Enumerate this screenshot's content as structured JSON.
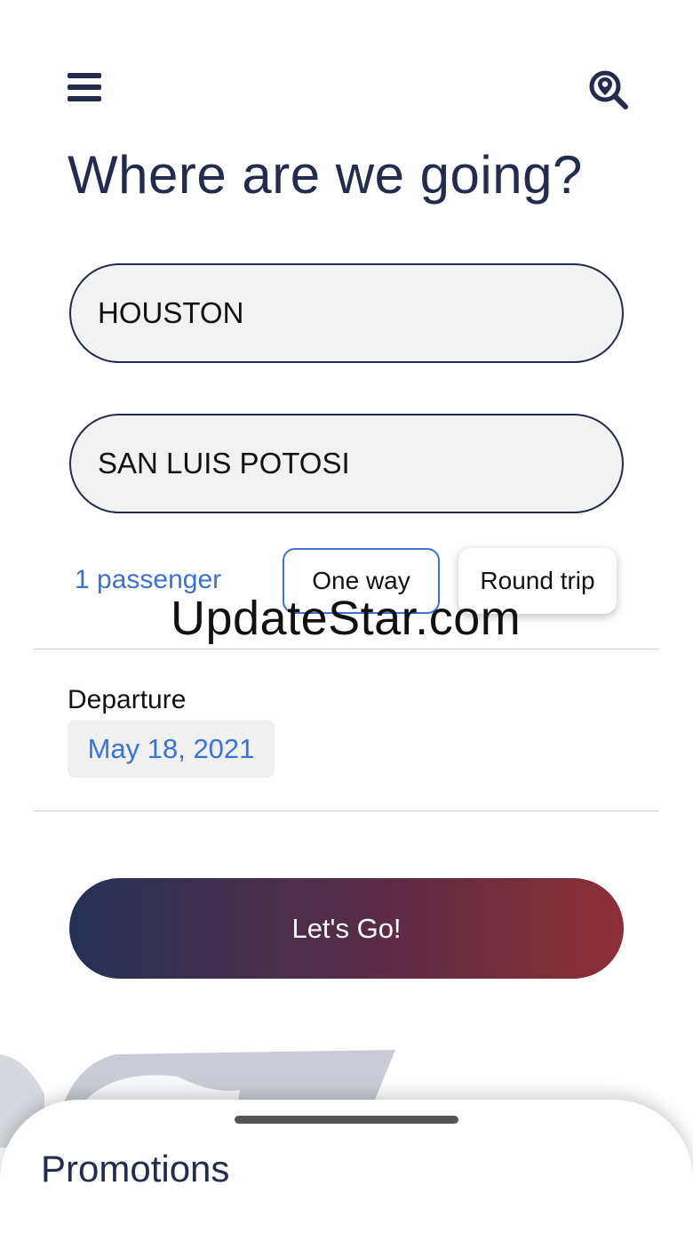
{
  "header": {
    "menu_icon": "hamburger-menu-icon",
    "search_icon": "location-search-icon",
    "title": "Where are we going?"
  },
  "search": {
    "origin_value": "HOUSTON",
    "destination_value": "SAN LUIS POTOSI"
  },
  "options": {
    "passengers": "1 passenger",
    "trip_types": [
      "One way",
      "Round trip"
    ],
    "selected_trip_type": "One way"
  },
  "watermark": "UpdateStar.com",
  "departure": {
    "label": "Departure",
    "date": "May 18, 2021"
  },
  "cta": {
    "label": "Let's Go!"
  },
  "promotions": {
    "title": "Promotions"
  },
  "colors": {
    "navy": "#232c4f",
    "link_blue": "#3a72d6",
    "gradient_start": "#263156",
    "gradient_end": "#8d2e35"
  }
}
